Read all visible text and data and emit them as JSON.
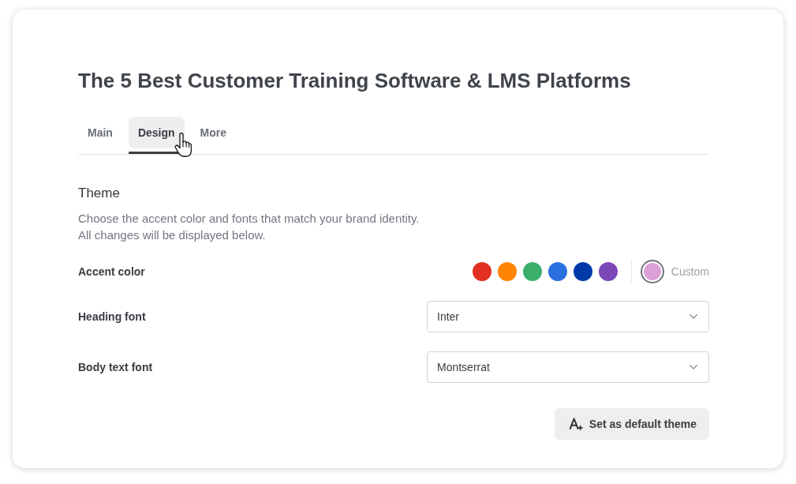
{
  "page": {
    "title": "The 5 Best Customer Training Software & LMS Platforms"
  },
  "tabs": [
    {
      "label": "Main",
      "selected": false,
      "hovered": false
    },
    {
      "label": "Design",
      "selected": true,
      "hovered": true
    },
    {
      "label": "More",
      "selected": false,
      "hovered": false
    }
  ],
  "theme": {
    "heading": "Theme",
    "description": [
      "Choose the accent color and fonts that match your brand identity.",
      "All changes will be displayed below."
    ],
    "accent_color": {
      "label": "Accent color",
      "swatches": [
        {
          "color": "#e1301f",
          "selected": false
        },
        {
          "color": "#ff8502",
          "selected": false
        },
        {
          "color": "#3aaf6b",
          "selected": false
        },
        {
          "color": "#2b70e0",
          "selected": false
        },
        {
          "color": "#003aa8",
          "selected": false
        },
        {
          "color": "#7b47b7",
          "selected": false
        }
      ],
      "custom": {
        "label": "Custom",
        "color": "#dd9fd8",
        "selected": true
      }
    },
    "fonts": [
      {
        "label": "Heading font",
        "value": "Inter"
      },
      {
        "label": "Body text font",
        "value": "Montserrat"
      }
    ],
    "default_button": {
      "label": "Set as default theme"
    }
  }
}
